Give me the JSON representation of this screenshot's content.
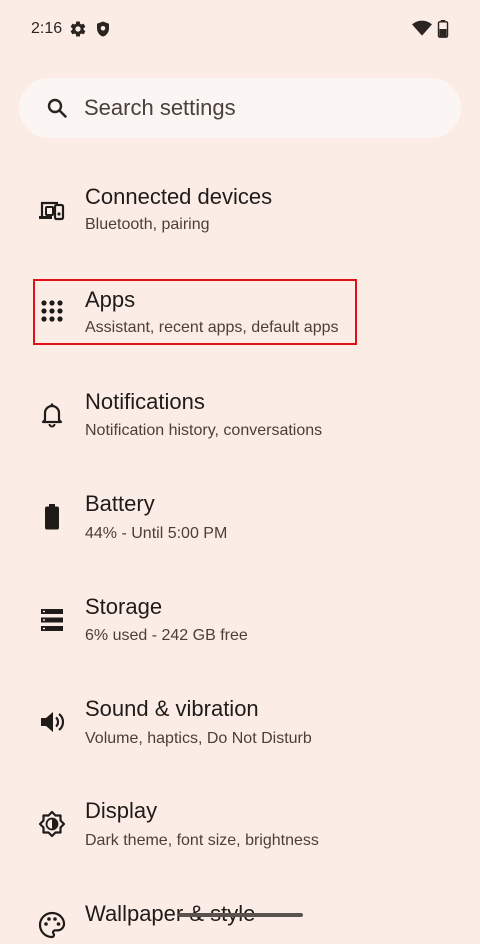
{
  "status": {
    "time": "2:16",
    "icons": [
      "gear-icon",
      "shield-icon",
      "wifi-icon",
      "battery-icon"
    ]
  },
  "search": {
    "placeholder": "Search settings"
  },
  "items": [
    {
      "title": "Connected devices",
      "subtitle": "Bluetooth, pairing",
      "icon": "connected-devices-icon"
    },
    {
      "title": "Apps",
      "subtitle": "Assistant, recent apps, default apps",
      "icon": "apps-grid-icon"
    },
    {
      "title": "Notifications",
      "subtitle": "Notification history, conversations",
      "icon": "bell-icon"
    },
    {
      "title": "Battery",
      "subtitle": "44% - Until 5:00 PM",
      "icon": "battery-icon"
    },
    {
      "title": "Storage",
      "subtitle": "6% used - 242 GB free",
      "icon": "storage-icon"
    },
    {
      "title": "Sound & vibration",
      "subtitle": "Volume, haptics, Do Not Disturb",
      "icon": "speaker-icon"
    },
    {
      "title": "Display",
      "subtitle": "Dark theme, font size, brightness",
      "icon": "brightness-icon"
    },
    {
      "title": "Wallpaper & style",
      "subtitle": "",
      "icon": "palette-icon"
    }
  ],
  "colors": {
    "background": "#fcece6",
    "search_bg": "#fbf6f3",
    "highlight": "#e3101c"
  }
}
